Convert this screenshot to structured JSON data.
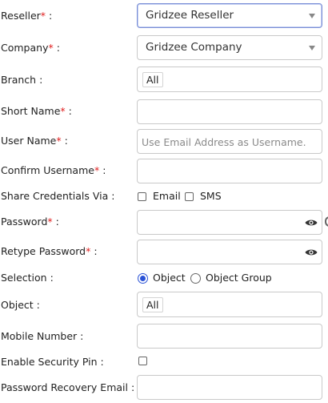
{
  "form": {
    "reseller": {
      "label": "Reseller",
      "required_mark": "*",
      "suffix": " :",
      "value": "Gridzee Reseller"
    },
    "company": {
      "label": "Company",
      "required_mark": "*",
      "suffix": " :",
      "value": "Gridzee Company"
    },
    "branch": {
      "label": "Branch :",
      "tag": "All"
    },
    "short_name": {
      "label": "Short Name",
      "required_mark": "*",
      "suffix": " :",
      "value": ""
    },
    "user_name": {
      "label": "User Name",
      "required_mark": "*",
      "suffix": " :",
      "placeholder": "Use Email Address as Username."
    },
    "confirm_username": {
      "label": "Confirm Username",
      "required_mark": "*",
      "suffix": " :",
      "value": ""
    },
    "share_credentials": {
      "label": "Share Credentials Via :",
      "options": [
        "Email",
        "SMS"
      ],
      "checked": [
        false,
        false
      ]
    },
    "password": {
      "label": "Password",
      "required_mark": "*",
      "suffix": " :",
      "value": ""
    },
    "retype_password": {
      "label": "Retype Password",
      "required_mark": "*",
      "suffix": " :",
      "value": ""
    },
    "selection": {
      "label": "Selection :",
      "options": [
        "Object",
        "Object Group"
      ],
      "selected": "Object"
    },
    "object": {
      "label": "Object :",
      "tag": "All"
    },
    "mobile_number": {
      "label": "Mobile Number :",
      "value": ""
    },
    "security_pin": {
      "label": "Enable Security Pin :",
      "checked": false
    },
    "recovery_email": {
      "label": "Password Recovery Email :",
      "value": ""
    }
  },
  "icons": {
    "password_toggle": "eye-icon",
    "dropdown": "chevron-down-icon"
  },
  "colors": {
    "required": "#e02020",
    "accent": "#2a52d6",
    "border": "#c9c9c9",
    "placeholder": "#8a8a8a"
  }
}
